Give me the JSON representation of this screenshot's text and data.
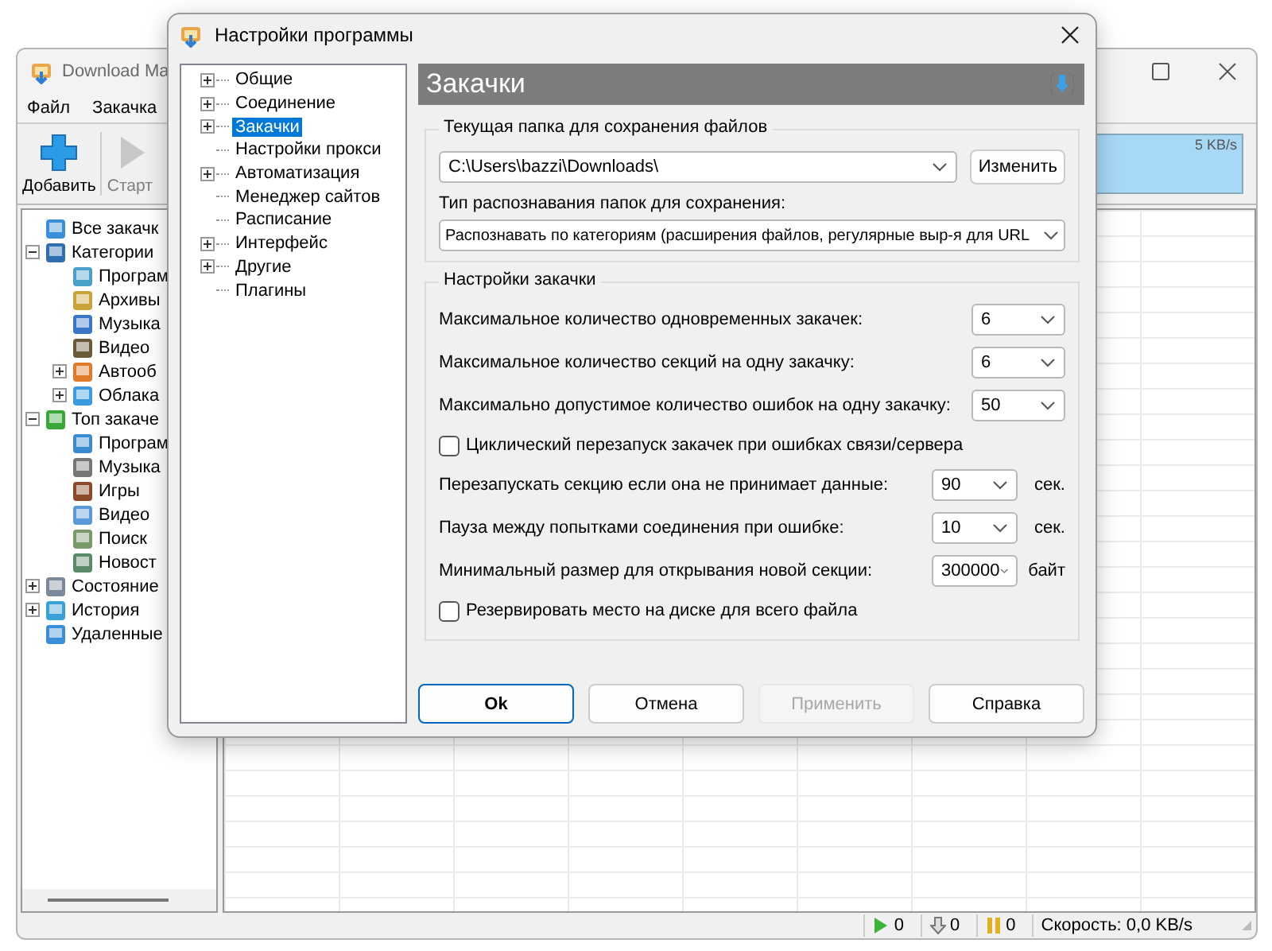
{
  "main_window": {
    "title": "Download Ma",
    "menu": [
      "Файл",
      "Закачка"
    ],
    "toolbar": [
      {
        "label": "Добавить",
        "disabled": false
      },
      {
        "label": "Старт",
        "disabled": true
      }
    ],
    "speed_graph": {
      "reading": "5 KB/s"
    },
    "tree": [
      {
        "label": "Все закачк"
      },
      {
        "label": "Категории",
        "expanded": true,
        "children": [
          {
            "label": "Програм"
          },
          {
            "label": "Архивы"
          },
          {
            "label": "Музыка"
          },
          {
            "label": "Видео"
          },
          {
            "label": "Автооб",
            "expanded": false
          },
          {
            "label": "Облака",
            "expanded": false
          }
        ]
      },
      {
        "label": "Топ закаче",
        "expanded": true,
        "children": [
          {
            "label": "Програм"
          },
          {
            "label": "Музыка"
          },
          {
            "label": "Игры"
          },
          {
            "label": "Видео"
          },
          {
            "label": "Поиск"
          },
          {
            "label": "Новост"
          }
        ]
      },
      {
        "label": "Состояние",
        "expanded": false
      },
      {
        "label": "История",
        "expanded": false
      },
      {
        "label": "Удаленные"
      }
    ],
    "status_bar": {
      "active": "0",
      "downloaded": "0",
      "paused": "0",
      "speed": "Скорость: 0,0 KB/s"
    }
  },
  "dialog": {
    "title": "Настройки программы",
    "tree": [
      {
        "label": "Общие",
        "expanded": false,
        "selected": false
      },
      {
        "label": "Соединение",
        "expanded": false,
        "selected": false
      },
      {
        "label": "Закачки",
        "expanded": false,
        "selected": true
      },
      {
        "label": "Настройки прокси",
        "selected": false
      },
      {
        "label": "Автоматизация",
        "expanded": false,
        "selected": false
      },
      {
        "label": "Менеджер сайтов",
        "selected": false
      },
      {
        "label": "Расписание",
        "selected": false
      },
      {
        "label": "Интерфейс",
        "expanded": false,
        "selected": false
      },
      {
        "label": "Другие",
        "expanded": false,
        "selected": false
      },
      {
        "label": "Плагины",
        "selected": false
      }
    ],
    "header": "Закачки",
    "folder_group": {
      "legend": "Текущая папка для сохранения файлов",
      "path": "C:\\Users\\bazzi\\Downloads\\",
      "change_button": "Изменить",
      "type_label": "Тип распознавания папок для сохранения:",
      "type_value": "Распознавать по категориям (расширения файлов, регулярные выр-я для URL"
    },
    "download_group": {
      "legend": "Настройки закачки",
      "rows": [
        {
          "kind": "select",
          "label": "Максимальное количество одновременных закачек:",
          "value": "6"
        },
        {
          "kind": "select",
          "label": "Максимальное количество секций на одну закачку:",
          "value": "6"
        },
        {
          "kind": "select",
          "label": "Максимально допустимое количество ошибок на одну закачку:",
          "value": "50"
        },
        {
          "kind": "checkbox",
          "label": "Циклический перезапуск закачек при ошибках связи/сервера",
          "checked": false
        },
        {
          "kind": "select",
          "label": "Перезапускать секцию если она не принимает данные:",
          "value": "90",
          "unit": "сек."
        },
        {
          "kind": "select",
          "label": "Пауза между попытками соединения при ошибке:",
          "value": "10",
          "unit": "сек."
        },
        {
          "kind": "select",
          "label": "Минимальный размер для открывания новой секции:",
          "value": "300000",
          "unit": "байт"
        },
        {
          "kind": "checkbox",
          "label": "Резервировать место на диске для всего файла",
          "checked": false
        }
      ]
    },
    "buttons": [
      {
        "label": "Ok",
        "default": true,
        "disabled": false
      },
      {
        "label": "Отмена",
        "default": false,
        "disabled": false
      },
      {
        "label": "Применить",
        "default": false,
        "disabled": true
      },
      {
        "label": "Справка",
        "default": false,
        "disabled": false
      }
    ]
  }
}
